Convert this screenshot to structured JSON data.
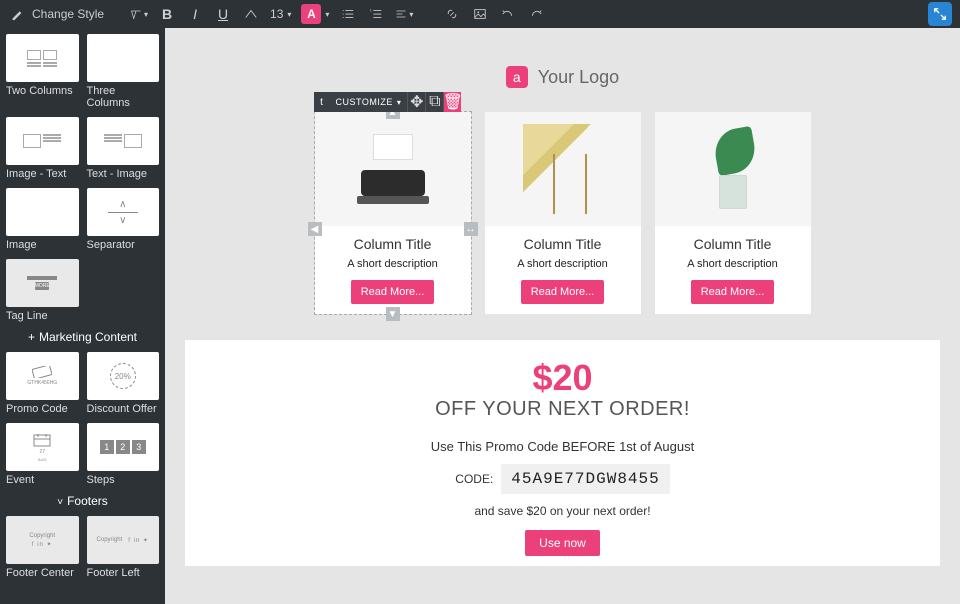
{
  "topbar": {
    "change_style": "Change Style",
    "font_size": "13",
    "text_color_glyph": "A"
  },
  "sidebar": {
    "items_row1": [
      {
        "label": "Two Columns"
      },
      {
        "label": "Three Columns"
      }
    ],
    "items_row2": [
      {
        "label": "Image - Text"
      },
      {
        "label": "Text - Image"
      }
    ],
    "items_row3": [
      {
        "label": "Image"
      },
      {
        "label": "Separator"
      }
    ],
    "items_row4": [
      {
        "label": "Tag Line"
      }
    ],
    "marketing_header": "Marketing Content",
    "items_row5": [
      {
        "label": "Promo Code"
      },
      {
        "label": "Discount Offer"
      }
    ],
    "items_row6": [
      {
        "label": "Event"
      },
      {
        "label": "Steps"
      }
    ],
    "footers_header": "Footers",
    "items_row7": [
      {
        "label": "Footer Center"
      },
      {
        "label": "Footer Left"
      }
    ]
  },
  "canvas": {
    "logo_text": "Your Logo",
    "logo_glyph": "a",
    "customize_label": "CUSTOMIZE",
    "columns": [
      {
        "title": "Column Title",
        "desc": "A short description",
        "btn": "Read More..."
      },
      {
        "title": "Column Title",
        "desc": "A short description",
        "btn": "Read More..."
      },
      {
        "title": "Column Title",
        "desc": "A short description",
        "btn": "Read More..."
      }
    ],
    "promo": {
      "amount": "$20",
      "sub": "OFF YOUR NEXT ORDER!",
      "use": "Use This Promo Code BEFORE 1st of August",
      "code_label": "CODE:",
      "code": "45A9E77DGW8455",
      "save": "and save $20 on your next order!",
      "use_now": "Use now"
    }
  },
  "misc": {
    "discount_badge": "20%",
    "event_date": "AUG",
    "footer_copy": "Copyright"
  }
}
